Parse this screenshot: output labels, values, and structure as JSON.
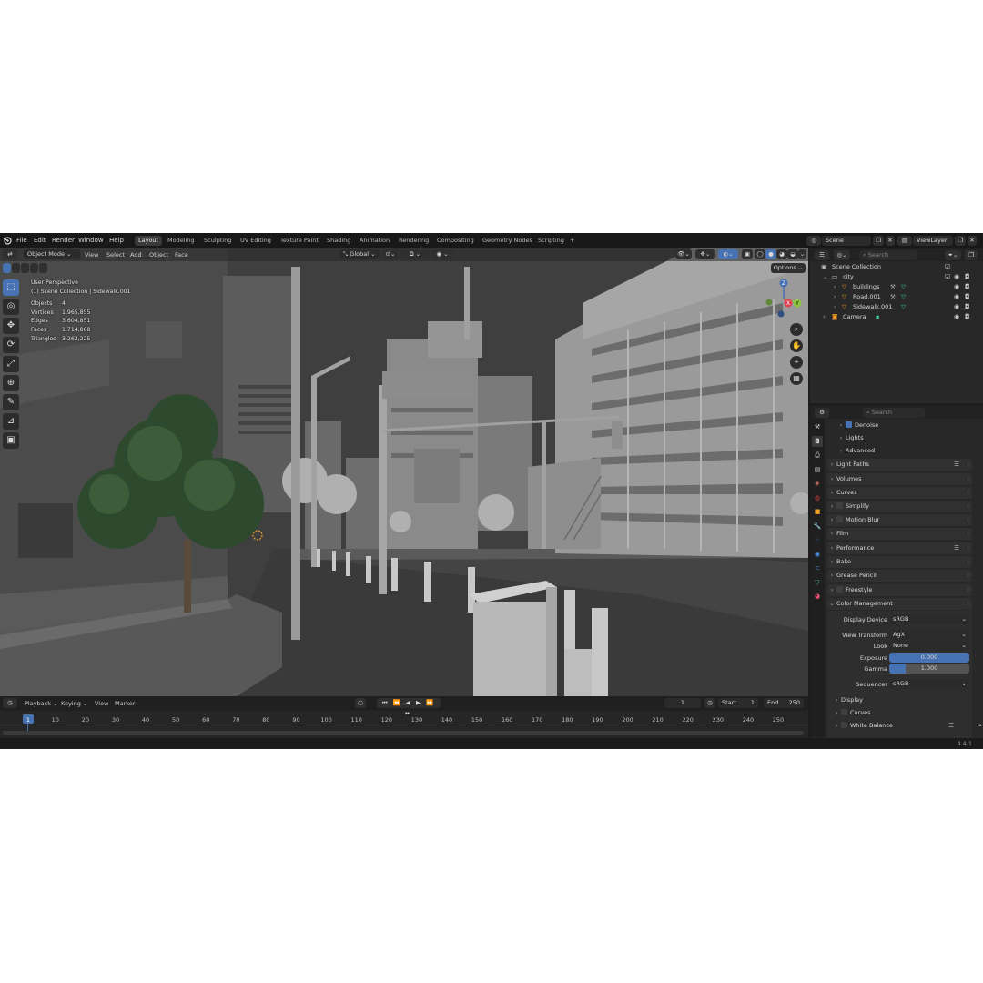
{
  "topbar": {
    "menus": [
      "File",
      "Edit",
      "Render",
      "Window",
      "Help"
    ],
    "workspaces": [
      "Layout",
      "Modeling",
      "Sculpting",
      "UV Editing",
      "Texture Paint",
      "Shading",
      "Animation",
      "Rendering",
      "Compositing",
      "Geometry Nodes",
      "Scripting"
    ],
    "active_workspace": "Layout",
    "add_tab": "+",
    "scene_name": "Scene",
    "view_layer_name": "ViewLayer"
  },
  "viewport": {
    "mode": "Object Mode",
    "menus": [
      "View",
      "Select",
      "Add",
      "Object",
      "Face"
    ],
    "orientation": "Global",
    "options_label": "Options",
    "perspective_label": "User Perspective",
    "context_label": "(1) Scene Collection | Sidewalk.001",
    "stats": [
      {
        "label": "Objects",
        "value": "4"
      },
      {
        "label": "Vertices",
        "value": "1,965,855"
      },
      {
        "label": "Edges",
        "value": "3,604,851"
      },
      {
        "label": "Faces",
        "value": "1,714,868"
      },
      {
        "label": "Triangles",
        "value": "3,262,225"
      }
    ],
    "gizmo": {
      "x": "X",
      "y": "Y",
      "z": "Z"
    }
  },
  "outliner": {
    "search_placeholder": "Search",
    "root": "Scene Collection",
    "items": [
      {
        "name": "city",
        "level": 1,
        "icon": "collection-icon"
      },
      {
        "name": "buildings",
        "level": 2,
        "icon": "mesh-icon"
      },
      {
        "name": "Road.001",
        "level": 2,
        "icon": "mesh-icon"
      },
      {
        "name": "Sidewalk.001",
        "level": 2,
        "icon": "mesh-icon"
      },
      {
        "name": "Camera",
        "level": 1,
        "icon": "camera-icon"
      }
    ]
  },
  "properties": {
    "search_placeholder": "Search",
    "panels": [
      {
        "label": "Denoise",
        "checkbox": true,
        "checked": true,
        "sub": true
      },
      {
        "label": "Lights",
        "sub": true
      },
      {
        "label": "Advanced",
        "sub": true
      },
      {
        "label": "Light Paths",
        "list_icon": true
      },
      {
        "label": "Volumes"
      },
      {
        "label": "Curves"
      },
      {
        "label": "Simplify",
        "checkbox": true,
        "checked": false
      },
      {
        "label": "Motion Blur",
        "checkbox": true,
        "checked": false
      },
      {
        "label": "Film"
      },
      {
        "label": "Performance",
        "list_icon": true
      },
      {
        "label": "Bake"
      },
      {
        "label": "Grease Pencil"
      },
      {
        "label": "Freestyle",
        "checkbox": true,
        "checked": false
      }
    ],
    "color_management": {
      "label": "Color Management",
      "display_device_label": "Display Device",
      "display_device": "sRGB",
      "view_transform_label": "View Transform",
      "view_transform": "AgX",
      "look_label": "Look",
      "look": "None",
      "exposure_label": "Exposure",
      "exposure": "0.000",
      "gamma_label": "Gamma",
      "gamma": "1.000",
      "gamma_fill": 0.2,
      "sequencer_label": "Sequencer",
      "sequencer": "sRGB",
      "sub_panels": [
        "Display",
        "Curves",
        "White Balance"
      ]
    }
  },
  "timeline": {
    "menus": [
      "Playback",
      "Keying",
      "View",
      "Marker"
    ],
    "current_frame": "1",
    "start_label": "Start",
    "start": "1",
    "end_label": "End",
    "end": "250",
    "ticks": [
      "1",
      "10",
      "20",
      "30",
      "40",
      "50",
      "60",
      "70",
      "80",
      "90",
      "100",
      "110",
      "120",
      "130",
      "140",
      "150",
      "160",
      "170",
      "180",
      "190",
      "200",
      "210",
      "220",
      "230",
      "240",
      "250"
    ]
  },
  "status": {
    "version": "4.4.1"
  },
  "colors": {
    "accent": "#4772b3",
    "header": "#181818",
    "panel": "#282828",
    "viewport": "#3d3d3d",
    "active_frame": "#4772b3"
  }
}
